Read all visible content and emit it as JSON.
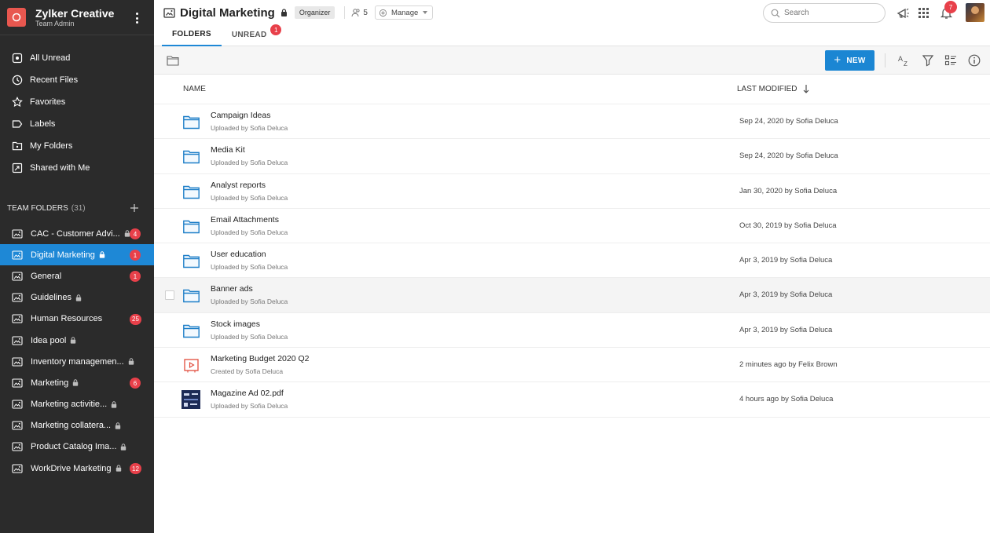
{
  "brand": {
    "name": "Zylker Creative",
    "role": "Team Admin",
    "accent": "#e8574f"
  },
  "nav": [
    {
      "label": "All Unread",
      "icon": "unread-icon"
    },
    {
      "label": "Recent Files",
      "icon": "clock-icon"
    },
    {
      "label": "Favorites",
      "icon": "star-icon"
    },
    {
      "label": "Labels",
      "icon": "label-icon"
    },
    {
      "label": "My Folders",
      "icon": "folder-icon"
    },
    {
      "label": "Shared with Me",
      "icon": "shared-icon"
    }
  ],
  "team_folders": {
    "header": "TEAM FOLDERS",
    "count": "(31)",
    "items": [
      {
        "label": "CAC - Customer Advi...",
        "locked": true,
        "badge": "4"
      },
      {
        "label": "Digital Marketing",
        "locked": true,
        "badge": "1",
        "active": true
      },
      {
        "label": "General",
        "locked": false,
        "badge": "1"
      },
      {
        "label": "Guidelines",
        "locked": true,
        "badge": ""
      },
      {
        "label": "Human Resources",
        "locked": false,
        "badge": "25"
      },
      {
        "label": "Idea pool",
        "locked": true,
        "badge": ""
      },
      {
        "label": "Inventory managemen...",
        "locked": true,
        "badge": ""
      },
      {
        "label": "Marketing",
        "locked": true,
        "badge": "6"
      },
      {
        "label": "Marketing activitie...",
        "locked": true,
        "badge": ""
      },
      {
        "label": "Marketing collatera...",
        "locked": true,
        "badge": ""
      },
      {
        "label": "Product Catalog Ima...",
        "locked": true,
        "badge": ""
      },
      {
        "label": "WorkDrive Marketing",
        "locked": true,
        "badge": "12"
      }
    ]
  },
  "header": {
    "title": "Digital Marketing",
    "role": "Organizer",
    "members": "5",
    "manage": "Manage",
    "notifications": "7",
    "search_placeholder": "Search"
  },
  "tabs": [
    {
      "label": "FOLDERS",
      "active": true,
      "badge": ""
    },
    {
      "label": "UNREAD",
      "active": false,
      "badge": "1"
    }
  ],
  "toolbar": {
    "new_label": "NEW"
  },
  "columns": {
    "name": "NAME",
    "modified": "LAST MODIFIED"
  },
  "files": [
    {
      "name": "Campaign Ideas",
      "sub": "Uploaded by Sofia Deluca",
      "modified": "Sep 24, 2020 by Sofia Deluca",
      "type": "folder"
    },
    {
      "name": "Media Kit",
      "sub": "Uploaded by Sofia Deluca",
      "modified": "Sep 24, 2020 by Sofia Deluca",
      "type": "folder"
    },
    {
      "name": "Analyst reports",
      "sub": "Uploaded by Sofia Deluca",
      "modified": "Jan 30, 2020 by Sofia Deluca",
      "type": "folder"
    },
    {
      "name": "Email Attachments",
      "sub": "Uploaded by Sofia Deluca",
      "modified": "Oct 30, 2019 by Sofia Deluca",
      "type": "folder"
    },
    {
      "name": "User education",
      "sub": "Uploaded by Sofia Deluca",
      "modified": "Apr 3, 2019 by Sofia Deluca",
      "type": "folder"
    },
    {
      "name": "Banner ads",
      "sub": "Uploaded by Sofia Deluca",
      "modified": "Apr 3, 2019 by Sofia Deluca",
      "type": "folder",
      "hover": true
    },
    {
      "name": "Stock images",
      "sub": "Uploaded by Sofia Deluca",
      "modified": "Apr 3, 2019 by Sofia Deluca",
      "type": "folder"
    },
    {
      "name": "Marketing Budget 2020 Q2",
      "sub": "Created by Sofia Deluca",
      "modified": "2 minutes ago by Felix Brown",
      "type": "presentation"
    },
    {
      "name": "Magazine Ad 02.pdf",
      "sub": "Uploaded by Sofia Deluca",
      "modified": "4 hours ago by Sofia Deluca",
      "type": "image"
    }
  ]
}
